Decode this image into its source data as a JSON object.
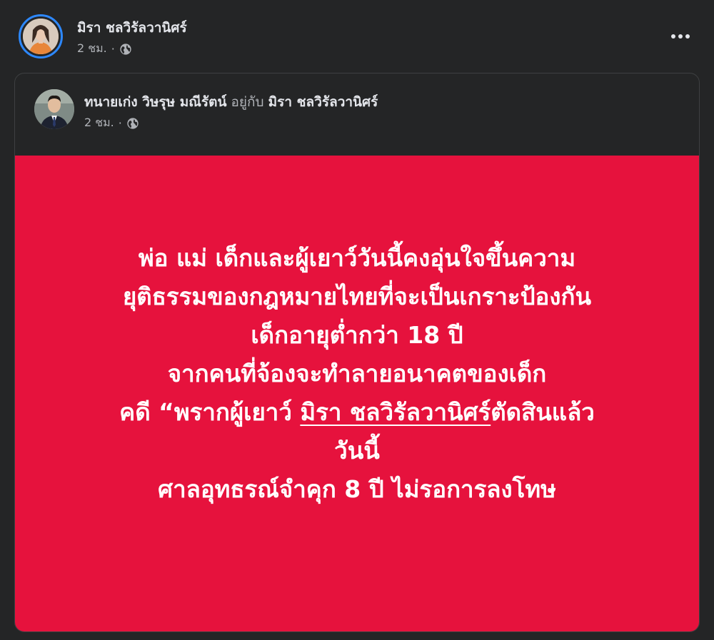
{
  "post": {
    "author": "มิรา ชลวิรัลวานิศร์",
    "time": "2 ชม.",
    "separator": "·",
    "privacy_icon": "globe-icon",
    "more_icon": "more-options-icon"
  },
  "shared_post": {
    "author": "ทนายเก่ง วิษรุษ มณีรัตน์",
    "with_text": "อยู่กับ",
    "tagged": "มิรา ชลวิรัลวานิศร์",
    "time": "2 ชม.",
    "separator": "·",
    "privacy_icon": "globe-icon"
  },
  "statement": {
    "line1": "พ่อ แม่ เด็กและผู้เยาว์วันนี้คงอุ่นใจขึ้นความ",
    "line2": "ยุติธรรมของกฎหมายไทยที่จะเป็นเกราะป้องกัน",
    "line3": "เด็กอายุต่ำกว่า 18 ปี",
    "line4": "จากคนที่จ้องจะทำลายอนาคตของเด็ก",
    "line5_prefix": "คดี “พรากผู้เยาว์ ",
    "line5_underlined": "มิรา ชลวิรัลวานิศร์",
    "line5_suffix": "ตัดสินแล้ว",
    "line6": "วันนี้",
    "line7": "ศาลอุทธรณ์จำคุก 8 ปี ไม่รอการลงโทษ"
  },
  "colors": {
    "background": "#242526",
    "panel_red": "#e6123d",
    "avatar_ring": "#2d88ff"
  }
}
